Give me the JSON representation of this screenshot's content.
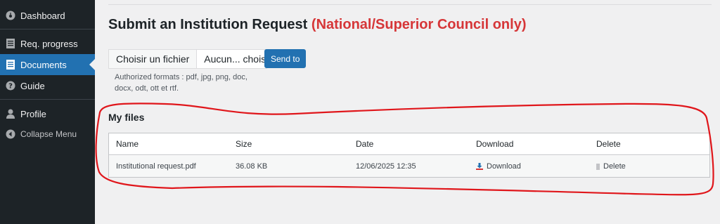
{
  "sidebar": {
    "items": [
      {
        "label": "Dashboard",
        "icon": "dashboard-icon"
      },
      {
        "label": "Req. progress",
        "icon": "document-icon"
      },
      {
        "label": "Documents",
        "icon": "documents-icon",
        "active": true
      },
      {
        "label": "Guide",
        "icon": "help-icon"
      },
      {
        "label": "Profile",
        "icon": "user-icon"
      }
    ],
    "collapse_label": "Collapse Menu"
  },
  "page": {
    "title_prefix": "Submit an ",
    "title_bold": "Institution Request",
    "title_red": "(National/Superior Council only)"
  },
  "upload": {
    "choose_label": "Choisir un fichier",
    "no_file_label": "Aucun... choisi",
    "send_label": "Send to",
    "formats_note": "Authorized formats : pdf, jpg, png, doc, docx, odt, ott et rtf."
  },
  "files": {
    "heading": "My files",
    "columns": [
      "Name",
      "Size",
      "Date",
      "Download",
      "Delete"
    ],
    "rows": [
      {
        "name": "Institutional request.pdf",
        "size": "36.08 KB",
        "date": "12/06/2025 12:35",
        "download": "Download",
        "delete": "Delete"
      }
    ]
  },
  "colors": {
    "sidebar_bg": "#1d2327",
    "active_bg": "#2271b1",
    "title_red": "#d63638",
    "annotation_red": "#e0161b",
    "link_blue": "#2271b1"
  }
}
